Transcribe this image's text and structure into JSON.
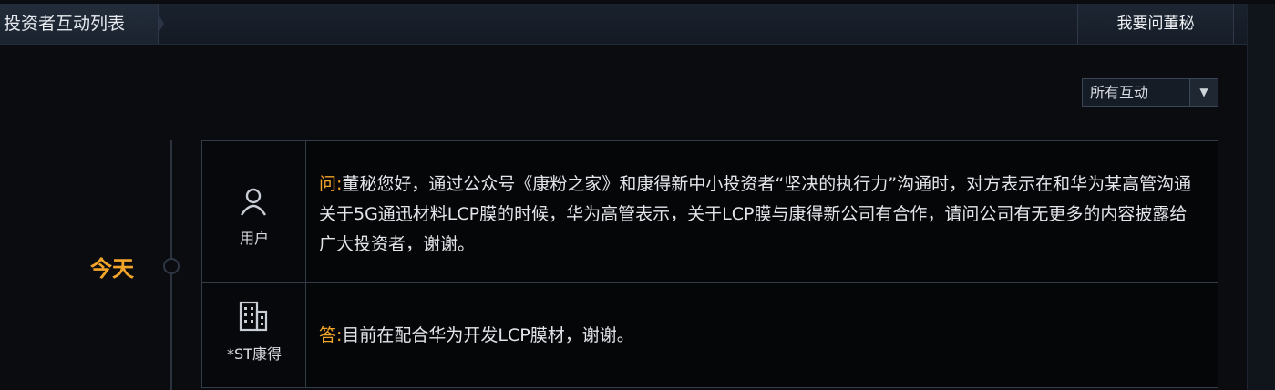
{
  "header": {
    "tab_title": "投资者互动列表",
    "ask_button": "我要问董秘"
  },
  "filter": {
    "selected": "所有互动"
  },
  "timeline": {
    "date_label": "今天"
  },
  "interaction": {
    "question": {
      "role": "用户",
      "prefix": "问:",
      "text": "董秘您好，通过公众号《康粉之家》和康得新中小投资者“坚决的执行力”沟通时，对方表示在和华为某高管沟通关于5G通迅材料LCP膜的时候，华为高管表示，关于LCP膜与康得新公司有合作，请问公司有无更多的内容披露给广大投资者，谢谢。"
    },
    "answer": {
      "role": "*ST康得",
      "prefix": "答:",
      "text": "目前在配合华为开发LCP膜材，谢谢。"
    }
  },
  "colors": {
    "accent": "#f3a52a",
    "background": "#0a0c10",
    "border": "#333b47"
  }
}
